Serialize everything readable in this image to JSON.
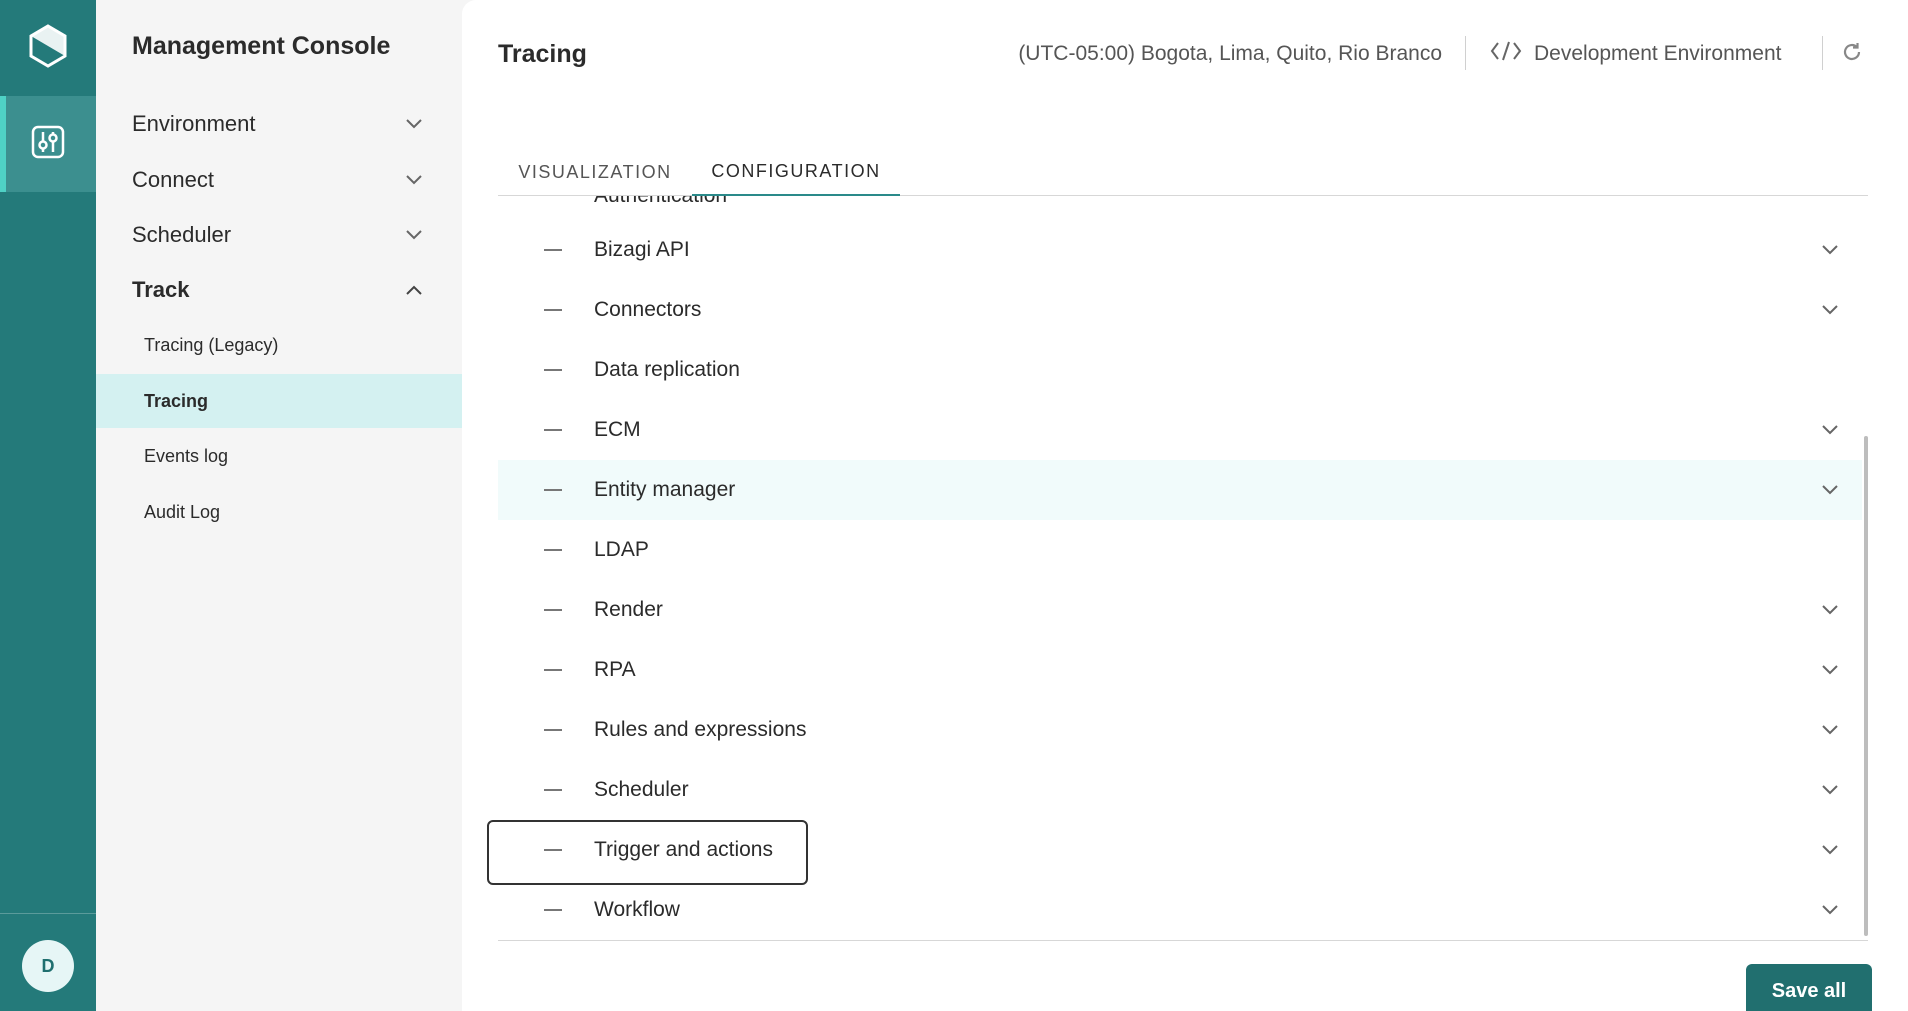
{
  "rail": {
    "logo_icon": "bizagi-logo-icon",
    "active_icon": "sliders-icon",
    "avatar_initial": "D"
  },
  "nav": {
    "title": "Management Console",
    "groups": [
      {
        "label": "Environment",
        "icon": "chevron-down-icon"
      },
      {
        "label": "Connect",
        "icon": "chevron-down-icon"
      },
      {
        "label": "Scheduler",
        "icon": "chevron-down-icon"
      },
      {
        "label": "Track",
        "icon": "chevron-up-icon"
      }
    ],
    "track_items": [
      {
        "label": "Tracing (Legacy)"
      },
      {
        "label": "Tracing",
        "active": true
      },
      {
        "label": "Events log"
      },
      {
        "label": "Audit Log"
      }
    ]
  },
  "header": {
    "title": "Tracing",
    "timezone": "(UTC-05:00) Bogota, Lima, Quito, Rio Branco",
    "environment": "Development Environment",
    "environment_icon": "code-icon",
    "refresh_icon": "refresh-icon"
  },
  "tabs": [
    {
      "label": "VISUALIZATION",
      "active": false
    },
    {
      "label": "CONFIGURATION",
      "active": true
    }
  ],
  "list": {
    "cut_label": "Authentication",
    "items": [
      {
        "label": "Bizagi API",
        "expandable": true
      },
      {
        "label": "Connectors",
        "expandable": true
      },
      {
        "label": "Data replication",
        "expandable": false
      },
      {
        "label": "ECM",
        "expandable": true
      },
      {
        "label": "Entity manager",
        "expandable": true
      },
      {
        "label": "LDAP",
        "expandable": false
      },
      {
        "label": "Render",
        "expandable": true
      },
      {
        "label": "RPA",
        "expandable": true
      },
      {
        "label": "Rules and expressions",
        "expandable": true
      },
      {
        "label": "Scheduler",
        "expandable": true
      },
      {
        "label": "Trigger and actions",
        "expandable": true
      },
      {
        "label": "Workflow",
        "expandable": true
      }
    ]
  },
  "footer": {
    "save_label": "Save all"
  },
  "colors": {
    "rail": "#247a7a",
    "accent": "#2a8a8a",
    "active_nav": "#d4f1f1",
    "button": "#216f6f"
  }
}
